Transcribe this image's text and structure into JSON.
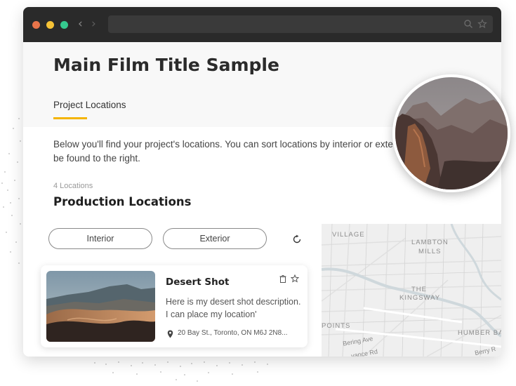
{
  "browser": {
    "traffic_lights": [
      "#e8744a",
      "#f5c236",
      "#35c98e"
    ],
    "back_icon": "chevron-left-icon",
    "forward_icon": "chevron-right-icon",
    "search_icon": "search-icon",
    "bookmark_icon": "star-icon"
  },
  "page": {
    "film_title": "Main Film Title Sample",
    "tab_label": "Project Locations",
    "accent_color": "#f4b400",
    "description": "Below you'll find your project's locations. You can sort locations by interior or exte… be found to the right.",
    "description_line1": "Below you'll find your project's locations. You can sort locations by interior or exte",
    "description_line2": "be found to the right.",
    "location_count": "4 Locations",
    "section_title": "Production Locations"
  },
  "filters": {
    "interior_label": "Interior",
    "exterior_label": "Exterior",
    "refresh_icon": "refresh-icon"
  },
  "location_card": {
    "title": "Desert Shot",
    "description": "Here is my desert shot description. I can place my location'",
    "address": "20 Bay St., Toronto, ON M6J 2N8...",
    "icons": [
      "trash-icon",
      "star-icon",
      "map-pin-icon"
    ]
  },
  "map": {
    "labels": [
      "VILLAGE",
      "LAMBTON",
      "MILLS",
      "THE",
      "KINGSWAY",
      "POINTS",
      "HUMBER BA"
    ],
    "roads": [
      "Bering Ave",
      "vance Rd",
      "Berry R"
    ]
  }
}
